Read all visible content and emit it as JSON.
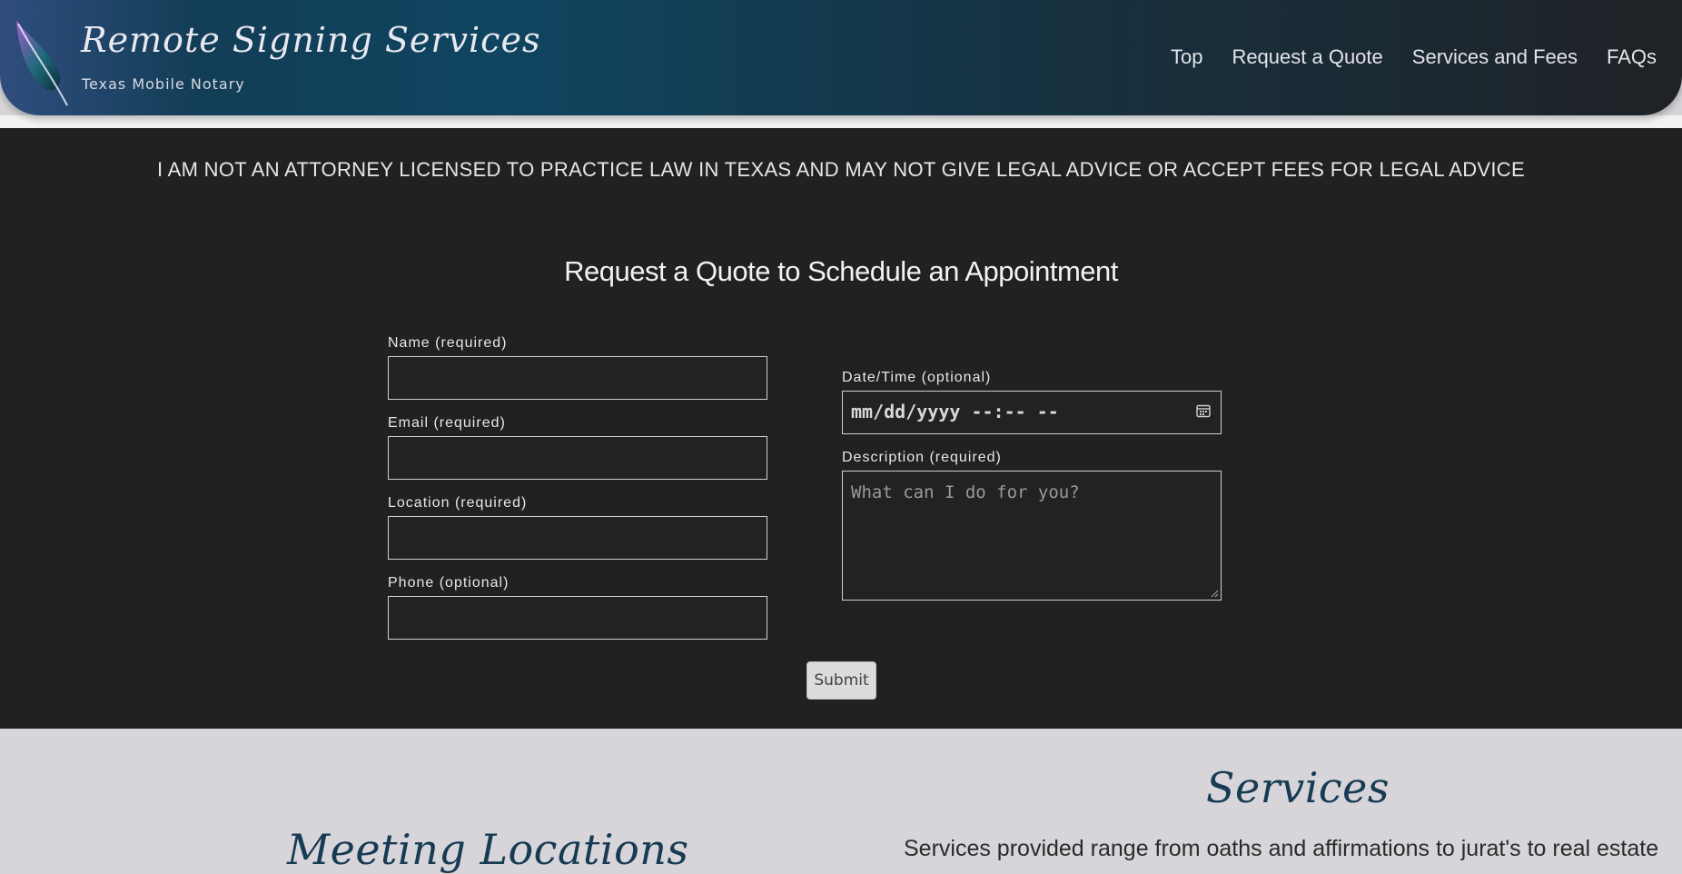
{
  "header": {
    "brand_title": "Remote Signing Services",
    "brand_subtitle": "Texas Mobile Notary",
    "nav": [
      "Top",
      "Request a Quote",
      "Services and Fees",
      "FAQs"
    ]
  },
  "disclaimer": "I AM NOT AN ATTORNEY LICENSED TO PRACTICE LAW IN TEXAS AND MAY NOT GIVE LEGAL ADVICE OR ACCEPT FEES FOR LEGAL ADVICE",
  "form": {
    "title": "Request a Quote to Schedule an Appointment",
    "fields": {
      "name_label": "Name (required)",
      "email_label": "Email (required)",
      "location_label": "Location (required)",
      "phone_label": "Phone (optional)",
      "datetime_label": "Date/Time (optional)",
      "datetime_value": "mm/dd/yyyy --:-- --",
      "description_label": "Description (required)",
      "description_placeholder": "What can I do for you?"
    },
    "submit_label": "Submit"
  },
  "sections": {
    "services_title": "Services",
    "services_text": "Services provided range from oaths and affirmations to jurat's to real estate",
    "meeting_title": "Meeting Locations"
  },
  "colors": {
    "dark_bg": "#212121",
    "light_bg": "#d7d5d9",
    "heading_blue": "#163b53"
  },
  "icons": {
    "logo": "feather-icon",
    "datetime": "calendar-icon"
  }
}
